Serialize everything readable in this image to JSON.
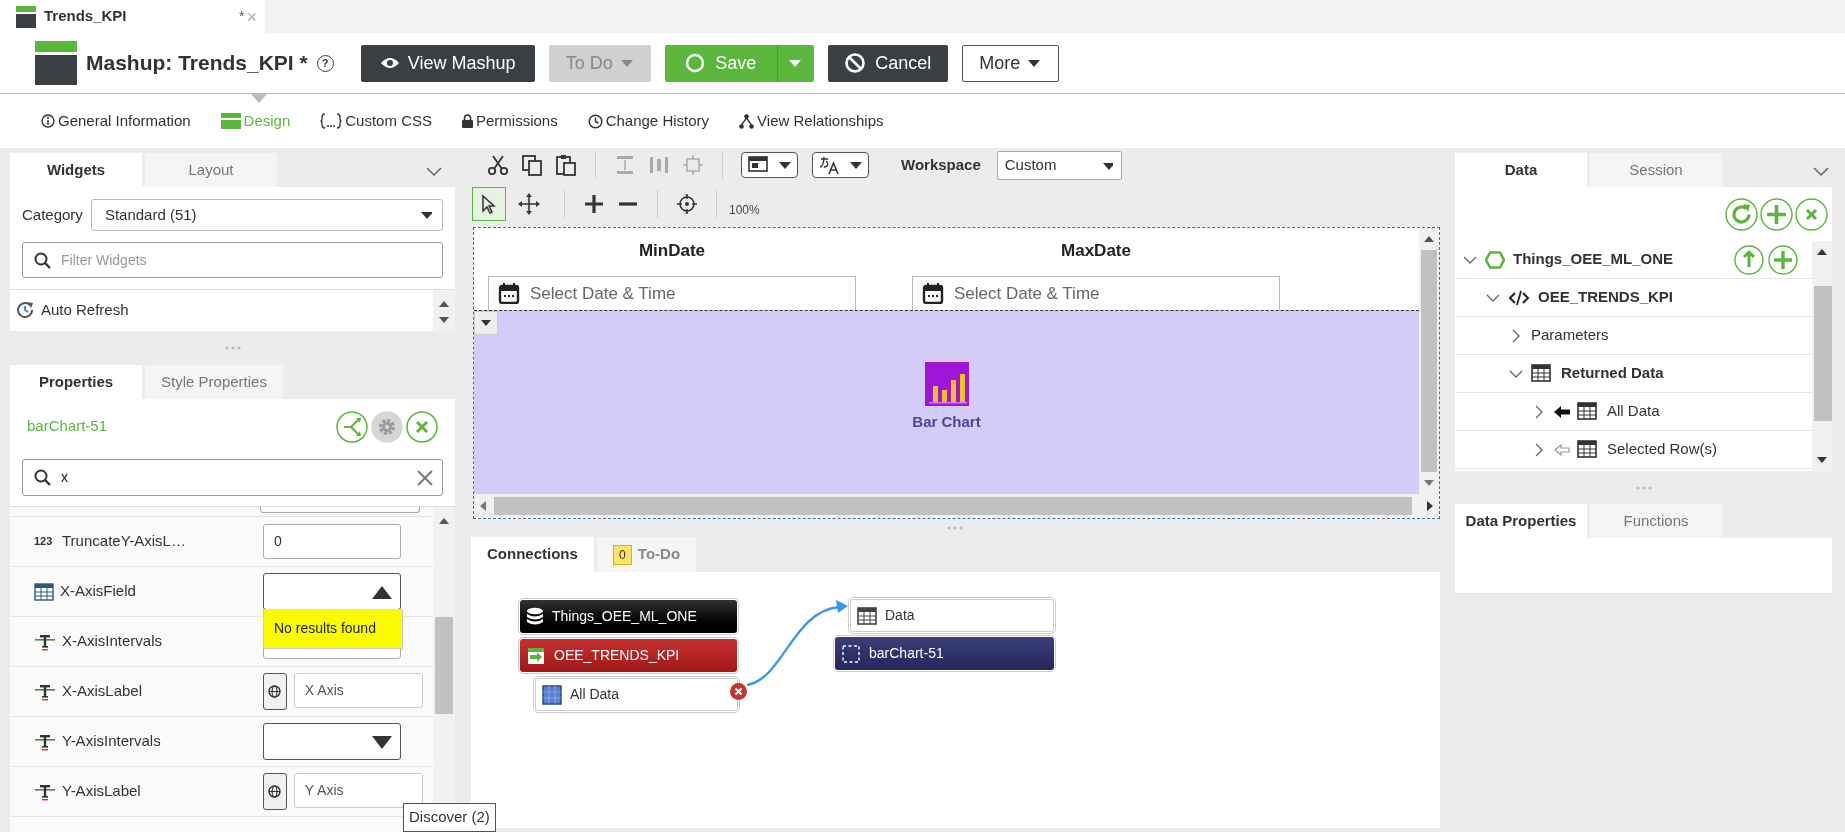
{
  "document_tab": {
    "title": "Trends_KPI",
    "modified_mark": "*",
    "close_glyph": "×"
  },
  "header": {
    "title": "Mashup: Trends_KPI *",
    "help": "?",
    "buttons": [
      {
        "kind": "view",
        "label": "View Mashup",
        "disabled": false
      },
      {
        "kind": "todo",
        "label": "To Do",
        "disabled": true
      },
      {
        "kind": "save",
        "label": "Save",
        "disabled": false
      },
      {
        "kind": "cancel",
        "label": "Cancel",
        "disabled": false
      },
      {
        "kind": "more",
        "label": "More",
        "disabled": false
      }
    ]
  },
  "nav_tabs": [
    {
      "kind": "info",
      "label": "General Information",
      "selected": false
    },
    {
      "kind": "design",
      "label": "Design",
      "selected": true
    },
    {
      "kind": "css",
      "label": "Custom CSS",
      "selected": false
    },
    {
      "kind": "permissions",
      "label": "Permissions",
      "selected": false
    },
    {
      "kind": "history",
      "label": "Change History",
      "selected": false
    },
    {
      "kind": "relationships",
      "label": "View Relationships",
      "selected": false
    }
  ],
  "widgets_panel": {
    "tabs": [
      {
        "label": "Widgets",
        "selected": true
      },
      {
        "label": "Layout",
        "selected": false
      }
    ],
    "category_label": "Category",
    "category_value": "Standard (51)",
    "filter_placeholder": "Filter Widgets",
    "items": [
      {
        "label": "Auto Refresh"
      }
    ]
  },
  "properties_panel": {
    "tabs": [
      {
        "label": "Properties",
        "selected": true
      },
      {
        "label": "Style Properties",
        "selected": false
      }
    ],
    "widget_name": "barChart-51",
    "search_value": "x",
    "rows": [
      {
        "kind": "number_text",
        "type_badge": "123",
        "name": "TruncateY-AxisL…",
        "value": "0"
      },
      {
        "kind": "infotable_dropdown",
        "name": "X-AxisField",
        "expanded": true,
        "dropdown_message": "No results found"
      },
      {
        "kind": "string_text",
        "name": "X-AxisIntervals"
      },
      {
        "kind": "string_localized",
        "name": "X-AxisLabel",
        "value": "X Axis"
      },
      {
        "kind": "string_dropdown",
        "name": "Y-AxisIntervals",
        "expanded": false
      },
      {
        "kind": "string_localized",
        "name": "Y-AxisLabel",
        "value": "Y Axis"
      }
    ]
  },
  "tooltip": "Discover (2)",
  "toolbar": {
    "workspace_label": "Workspace",
    "workspace_value": "Custom",
    "zoom": "100%",
    "pointer_tools": [
      {
        "kind": "select",
        "selected": true
      },
      {
        "kind": "move",
        "selected": false
      }
    ]
  },
  "canvas": {
    "date_widgets": [
      {
        "label": "MinDate",
        "placeholder": "Select Date & Time"
      },
      {
        "label": "MaxDate",
        "placeholder": "Select Date & Time"
      }
    ],
    "chart_widget": {
      "label": "Bar Chart"
    }
  },
  "bottom_tabs": [
    {
      "kind": "connections",
      "label": "Connections",
      "selected": true
    },
    {
      "kind": "todo",
      "label": "To-Do",
      "count": "0",
      "selected": false
    }
  ],
  "connections": {
    "sources": [
      {
        "kind": "thing",
        "label": "Things_OEE_ML_ONE"
      },
      {
        "kind": "service",
        "label": "OEE_TRENDS_KPI"
      },
      {
        "kind": "output",
        "label": "All Data"
      }
    ],
    "targets": [
      {
        "kind": "property",
        "label": "Data"
      },
      {
        "kind": "widget",
        "label": "barChart-51"
      }
    ]
  },
  "data_panel": {
    "tabs": [
      {
        "label": "Data",
        "selected": true
      },
      {
        "label": "Session",
        "selected": false
      }
    ],
    "tree": [
      {
        "kind": "thing",
        "label": "Things_OEE_ML_ONE",
        "expanded": true,
        "children": [
          {
            "kind": "service",
            "label": "OEE_TRENDS_KPI",
            "expanded": true,
            "children": [
              {
                "kind": "group",
                "label": "Parameters",
                "expanded": false
              },
              {
                "kind": "infotable",
                "label": "Returned Data",
                "expanded": true,
                "children": [
                  {
                    "kind": "output",
                    "label": "All Data",
                    "expanded": false
                  },
                  {
                    "kind": "selected",
                    "label": "Selected Row(s)",
                    "expanded": false
                  }
                ]
              }
            ]
          }
        ]
      }
    ]
  },
  "data_properties_tabs": [
    {
      "label": "Data Properties",
      "selected": true
    },
    {
      "label": "Functions",
      "selected": false
    }
  ]
}
